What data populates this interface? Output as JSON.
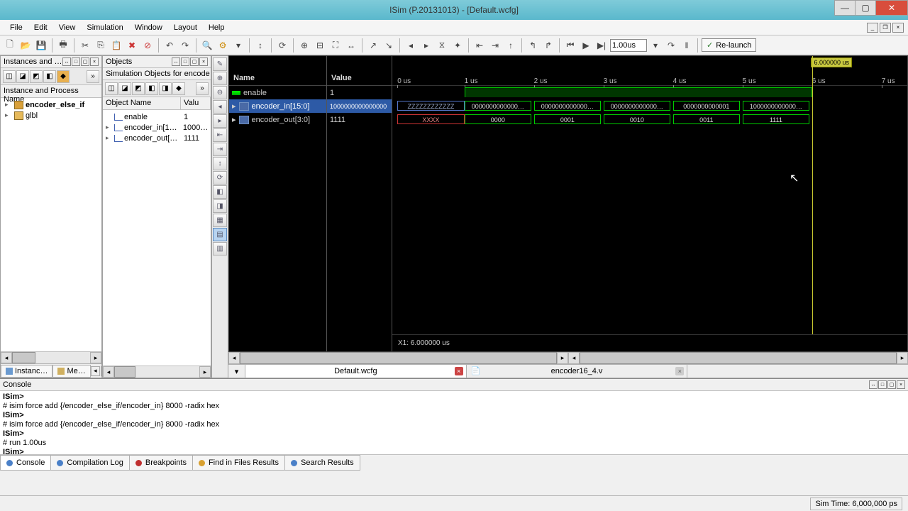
{
  "window": {
    "title": "ISim (P.20131013) - [Default.wcfg]"
  },
  "menu": [
    "File",
    "Edit",
    "View",
    "Simulation",
    "Window",
    "Layout",
    "Help"
  ],
  "toolbar": {
    "run_time": "1.00us",
    "relaunch": "Re-launch"
  },
  "instances_panel": {
    "title": "Instances and …",
    "column": "Instance and Process Name",
    "items": [
      {
        "name": "encoder_else_if",
        "bold": true
      },
      {
        "name": "glbl",
        "bold": false
      }
    ],
    "tabs": [
      "Instanc…",
      "Me…"
    ]
  },
  "objects_panel": {
    "title": "Objects",
    "subtitle": "Simulation Objects for encode…",
    "columns": [
      "Object Name",
      "Valu"
    ],
    "rows": [
      {
        "name": "enable",
        "value": "1"
      },
      {
        "name": "encoder_in[1…",
        "value": "1000…"
      },
      {
        "name": "encoder_out[…",
        "value": "1111"
      }
    ]
  },
  "wave": {
    "name_header": "Name",
    "value_header": "Value",
    "signals": [
      {
        "name": "enable",
        "value": "1",
        "kind": "bit",
        "selected": false
      },
      {
        "name": "encoder_in[15:0]",
        "value": "1000000000000000",
        "kind": "bus",
        "selected": true
      },
      {
        "name": "encoder_out[3:0]",
        "value": "1111",
        "kind": "bus",
        "selected": false
      }
    ],
    "ticks": [
      "0 us",
      "1 us",
      "2 us",
      "3 us",
      "4 us",
      "5 us",
      "6 us",
      "7 us"
    ],
    "marker": "6.000000 us",
    "cursor_text": "X1: 6.000000 us",
    "encoder_in_segs": [
      {
        "text": "ZZZZZZZZZZZZ",
        "cls": "z"
      },
      {
        "text": "0000000000000…",
        "cls": ""
      },
      {
        "text": "0000000000000…",
        "cls": ""
      },
      {
        "text": "0000000000000…",
        "cls": ""
      },
      {
        "text": "0000000000001",
        "cls": ""
      },
      {
        "text": "1000000000000…",
        "cls": ""
      }
    ],
    "encoder_out_segs": [
      {
        "text": "XXXX",
        "cls": "x"
      },
      {
        "text": "0000",
        "cls": ""
      },
      {
        "text": "0001",
        "cls": ""
      },
      {
        "text": "0010",
        "cls": ""
      },
      {
        "text": "0011",
        "cls": ""
      },
      {
        "text": "1111",
        "cls": ""
      }
    ]
  },
  "doc_tabs": [
    {
      "label": "Default.wcfg",
      "active": true,
      "closable": true
    },
    {
      "label": "encoder16_4.v",
      "active": false,
      "closable": true
    }
  ],
  "console": {
    "title": "Console",
    "lines": [
      {
        "prompt": true,
        "text": "ISim>"
      },
      {
        "prompt": false,
        "text": "# isim force add {/encoder_else_if/encoder_in} 8000 -radix hex"
      },
      {
        "prompt": true,
        "text": "ISim>"
      },
      {
        "prompt": false,
        "text": "# isim force add {/encoder_else_if/encoder_in} 8000 -radix hex"
      },
      {
        "prompt": true,
        "text": "ISim>"
      },
      {
        "prompt": false,
        "text": "# run 1.00us"
      },
      {
        "prompt": true,
        "text": "ISim>"
      }
    ],
    "tabs": [
      {
        "label": "Console",
        "color": "#4a80c8",
        "active": true
      },
      {
        "label": "Compilation Log",
        "color": "#4a80c8"
      },
      {
        "label": "Breakpoints",
        "color": "#c03030"
      },
      {
        "label": "Find in Files Results",
        "color": "#d8a030"
      },
      {
        "label": "Search Results",
        "color": "#4a80c8"
      }
    ]
  },
  "status": {
    "sim_time": "Sim Time: 6,000,000 ps"
  }
}
